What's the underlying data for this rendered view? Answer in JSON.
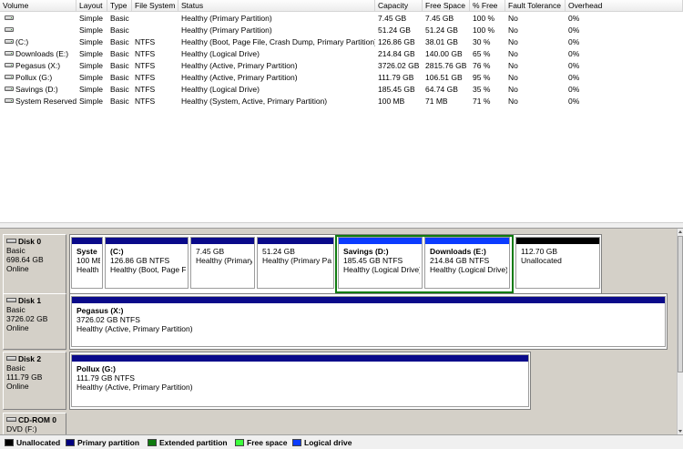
{
  "columns": [
    "Volume",
    "Layout",
    "Type",
    "File System",
    "Status",
    "Capacity",
    "Free Space",
    "% Free",
    "Fault Tolerance",
    "Overhead"
  ],
  "volumes": [
    {
      "name": "",
      "layout": "Simple",
      "type": "Basic",
      "fs": "",
      "status": "Healthy (Primary Partition)",
      "capacity": "7.45 GB",
      "free": "7.45 GB",
      "pct": "100 %",
      "fault": "No",
      "overhead": "0%"
    },
    {
      "name": "",
      "layout": "Simple",
      "type": "Basic",
      "fs": "",
      "status": "Healthy (Primary Partition)",
      "capacity": "51.24 GB",
      "free": "51.24 GB",
      "pct": "100 %",
      "fault": "No",
      "overhead": "0%"
    },
    {
      "name": "(C:)",
      "layout": "Simple",
      "type": "Basic",
      "fs": "NTFS",
      "status": "Healthy (Boot, Page File, Crash Dump, Primary Partition)",
      "capacity": "126.86 GB",
      "free": "38.01 GB",
      "pct": "30 %",
      "fault": "No",
      "overhead": "0%"
    },
    {
      "name": "Downloads (E:)",
      "layout": "Simple",
      "type": "Basic",
      "fs": "NTFS",
      "status": "Healthy (Logical Drive)",
      "capacity": "214.84 GB",
      "free": "140.00 GB",
      "pct": "65 %",
      "fault": "No",
      "overhead": "0%"
    },
    {
      "name": "Pegasus (X:)",
      "layout": "Simple",
      "type": "Basic",
      "fs": "NTFS",
      "status": "Healthy (Active, Primary Partition)",
      "capacity": "3726.02 GB",
      "free": "2815.76 GB",
      "pct": "76 %",
      "fault": "No",
      "overhead": "0%"
    },
    {
      "name": "Pollux (G:)",
      "layout": "Simple",
      "type": "Basic",
      "fs": "NTFS",
      "status": "Healthy (Active, Primary Partition)",
      "capacity": "111.79 GB",
      "free": "106.51 GB",
      "pct": "95 %",
      "fault": "No",
      "overhead": "0%"
    },
    {
      "name": "Savings (D:)",
      "layout": "Simple",
      "type": "Basic",
      "fs": "NTFS",
      "status": "Healthy (Logical Drive)",
      "capacity": "185.45 GB",
      "free": "64.74 GB",
      "pct": "35 %",
      "fault": "No",
      "overhead": "0%"
    },
    {
      "name": "System Reserved",
      "layout": "Simple",
      "type": "Basic",
      "fs": "NTFS",
      "status": "Healthy (System, Active, Primary Partition)",
      "capacity": "100 MB",
      "free": "71 MB",
      "pct": "71 %",
      "fault": "No",
      "overhead": "0%"
    }
  ],
  "disks": [
    {
      "name": "Disk 0",
      "kind": "Basic",
      "size": "698.64 GB",
      "state": "Online",
      "partitions": [
        {
          "name": "Syste",
          "size": "100 ME",
          "status": "Health",
          "kind": "primary"
        },
        {
          "name": "(C:)",
          "size": "126.86 GB NTFS",
          "status": "Healthy (Boot, Page Fi",
          "kind": "primary"
        },
        {
          "name": "",
          "size": "7.45 GB",
          "status": "Healthy (Primary",
          "kind": "primary"
        },
        {
          "name": "",
          "size": "51.24 GB",
          "status": "Healthy (Primary Par",
          "kind": "primary"
        },
        {
          "name": "Savings (D:)",
          "size": "185.45 GB NTFS",
          "status": "Healthy (Logical Drive)",
          "kind": "logical"
        },
        {
          "name": "Downloads (E:)",
          "size": "214.84 GB NTFS",
          "status": "Healthy (Logical Drive)",
          "kind": "logical"
        },
        {
          "name": "",
          "size": "112.70 GB",
          "status": "Unallocated",
          "kind": "unallocated"
        }
      ]
    },
    {
      "name": "Disk 1",
      "kind": "Basic",
      "size": "3726.02 GB",
      "state": "Online",
      "partitions": [
        {
          "name": "Pegasus (X:)",
          "size": "3726.02 GB NTFS",
          "status": "Healthy (Active, Primary Partition)",
          "kind": "primary"
        }
      ]
    },
    {
      "name": "Disk 2",
      "kind": "Basic",
      "size": "111.79 GB",
      "state": "Online",
      "partitions": [
        {
          "name": "Pollux (G:)",
          "size": "111.79 GB NTFS",
          "status": "Healthy (Active, Primary Partition)",
          "kind": "primary"
        }
      ]
    },
    {
      "name": "CD-ROM 0",
      "kind": "DVD (F:)",
      "size": "",
      "state": "",
      "partitions": []
    }
  ],
  "legend": [
    {
      "label": "Unallocated",
      "color": "#000000"
    },
    {
      "label": "Primary partition",
      "color": "#00007f"
    },
    {
      "label": "Extended partition",
      "color": "#0f7b0f"
    },
    {
      "label": "Free space",
      "color": "#3cff3c"
    },
    {
      "label": "Logical drive",
      "color": "#0b3bff"
    }
  ],
  "colors": {
    "primary": "#0a0a8a",
    "logical": "#0b3bff",
    "unallocated": "#000000",
    "extended": "#0f7b0f"
  }
}
